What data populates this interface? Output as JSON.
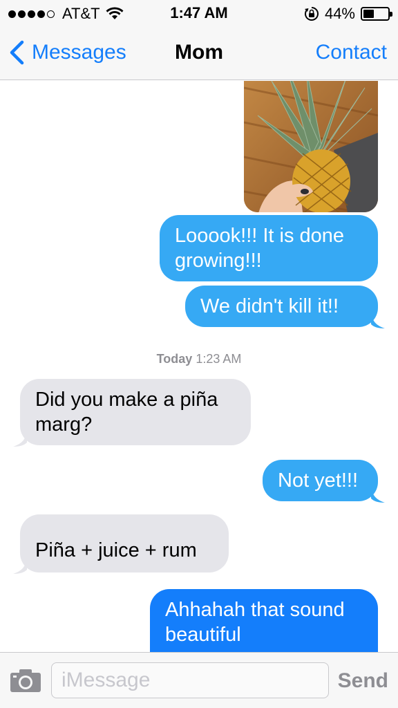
{
  "status_bar": {
    "signal_dots_filled": 4,
    "signal_dots_total": 5,
    "carrier": "AT&T",
    "time": "1:47 AM",
    "battery_percent": "44%",
    "battery_level": 0.44
  },
  "nav": {
    "back_label": "Messages",
    "title": "Mom",
    "right_label": "Contact"
  },
  "conversation": {
    "photo": {
      "subject": "small pineapple held in hand over a wooden table"
    },
    "messages": [
      {
        "direction": "outgoing",
        "text": "Looook!!! It is done growing!!!"
      },
      {
        "direction": "outgoing",
        "text": "We didn't kill it!!"
      },
      {
        "direction": "incoming",
        "text": "Did you make a piña marg?"
      },
      {
        "direction": "outgoing",
        "text": "Not yet!!!"
      },
      {
        "direction": "incoming",
        "text": "Piña + juice + rum"
      },
      {
        "direction": "outgoing",
        "text": "Ahhahah that sound beautiful"
      }
    ],
    "timestamp": {
      "day": "Today",
      "time": "1:23 AM"
    }
  },
  "input_bar": {
    "placeholder": "iMessage",
    "value": "",
    "send_label": "Send"
  },
  "colors": {
    "accent_blue": "#147efb",
    "sent_bubble": "#36a9f4",
    "received_bubble": "#e5e5ea",
    "bar_background": "#f7f7f7"
  },
  "icons": [
    "wifi-icon",
    "orientation-lock-icon",
    "battery-icon",
    "chevron-left-icon",
    "camera-icon"
  ]
}
